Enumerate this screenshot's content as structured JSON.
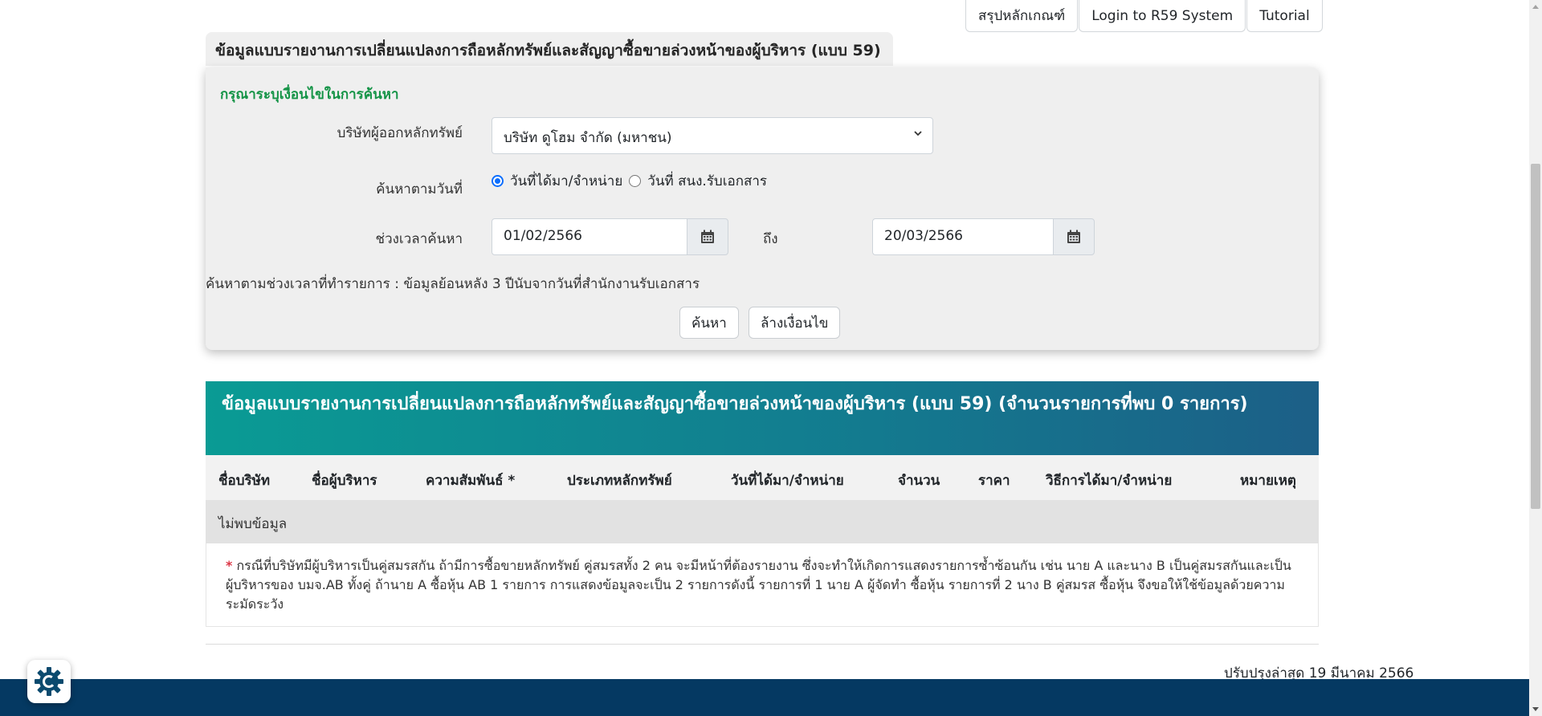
{
  "nav": {
    "btn_criteria": "สรุปหลักเกณฑ์",
    "btn_login": "Login to R59 System",
    "btn_tutorial": "Tutorial"
  },
  "section_title": "ข้อมูลแบบรายงานการเปลี่ยนแปลงการถือหลักทรัพย์และสัญญาซื้อขายล่วงหน้าของผู้บริหาร (แบบ 59)",
  "search": {
    "heading": "กรุณาระบุเงื่อนไขในการค้นหา",
    "issuer_label": "บริษัทผู้ออกหลักทรัพย์",
    "issuer_value": "บริษัท ดูโฮม จำกัด (มหาชน)",
    "date_by_label": "ค้นหาตามวันที่",
    "radio_acquire": "วันที่ได้มา/จำหน่าย",
    "radio_received": "วันที่ สนง.รับเอกสาร",
    "period_label": "ช่วงเวลาค้นหา",
    "date_from": "01/02/2566",
    "to_label": "ถึง",
    "date_to": "20/03/2566",
    "note": "ค้นหาตามช่วงเวลาที่ทำรายการ : ข้อมูลย้อนหลัง 3 ปีนับจากวันที่สำนักงานรับเอกสาร",
    "btn_search": "ค้นหา",
    "btn_clear": "ล้างเงื่อนไข"
  },
  "results": {
    "header": "ข้อมูลแบบรายงานการเปลี่ยนแปลงการถือหลักทรัพย์และสัญญาซื้อขายล่วงหน้าของผู้บริหาร (แบบ 59) (จำนวนรายการที่พบ 0 รายการ)",
    "columns": [
      "ชื่อบริษัท",
      "ชื่อผู้บริหาร",
      "ความสัมพันธ์ *",
      "ประเภทหลักทรัพย์",
      "วันที่ได้มา/จำหน่าย",
      "จำนวน",
      "ราคา",
      "วิธีการได้มา/จำหน่าย",
      "หมายเหตุ"
    ],
    "empty_text": "ไม่พบข้อมูล",
    "footnote_star": "*",
    "footnote": "กรณีที่บริษัทมีผู้บริหารเป็นคู่สมรสกัน ถ้ามีการซื้อขายหลักทรัพย์ คู่สมรสทั้ง 2 คน จะมีหน้าที่ต้องรายงาน ซึ่งจะทำให้เกิดการแสดงรายการซ้ำซ้อนกัน เช่น นาย A และนาง B เป็นคู่สมรสกันและเป็นผู้บริหารของ บมจ.AB ทั้งคู่ ถ้านาย A ซื้อหุ้น AB 1 รายการ การแสดงข้อมูลจะเป็น 2 รายการดังนี้ รายการที่ 1 นาย A ผู้จัดทำ ซื้อหุ้น รายการที่ 2 นาง B คู่สมรส ซื้อหุ้น จึงขอให้ใช้ข้อมูลด้วยความระมัดระวัง"
  },
  "updated": "ปรับปรุงล่าสุด 19 มีนาคม 2566",
  "colors": {
    "heading_green": "#159447",
    "header_gradient_start": "#0a9b94",
    "header_gradient_end": "#1c5f87",
    "footer_navy": "#053962",
    "radio_blue": "#0d6efd"
  },
  "icons": {
    "calendar": "calendar-icon",
    "caret": "chevron-down-icon",
    "badge": "gear-c-icon"
  }
}
